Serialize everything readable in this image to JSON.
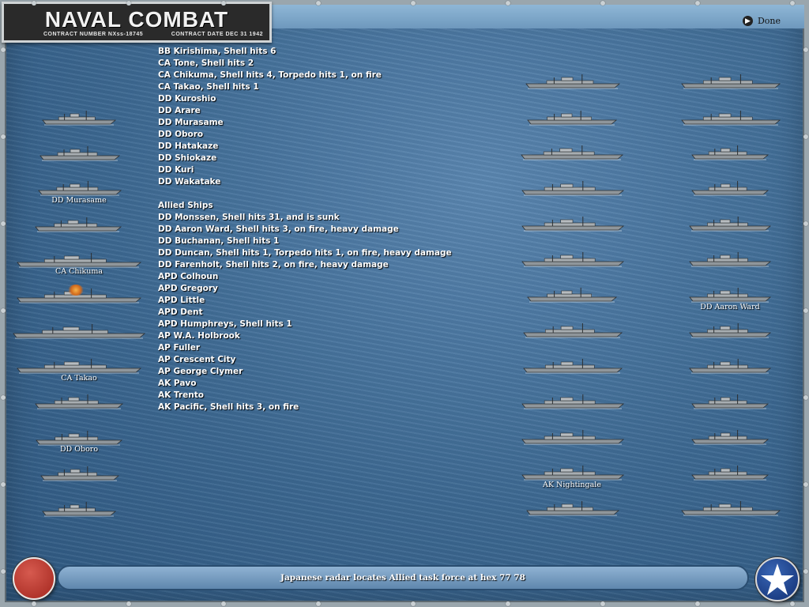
{
  "game": {
    "title": "NAVAL COMBAT",
    "contract_number": "CONTRACT NUMBER   NXss-18745",
    "contract_date": "CONTRACT DATE  DEC  31  1942"
  },
  "done_label": "Done",
  "report_lines": [
    "BB Kirishima, Shell hits 6",
    "CA Tone, Shell hits 2",
    "CA Chikuma, Shell hits 4, Torpedo hits 1,  on fire",
    "CA Takao, Shell hits 1",
    "DD Kuroshio",
    "DD Arare",
    "DD Murasame",
    "DD Oboro",
    "DD Hatakaze",
    "DD Shiokaze",
    "DD Kuri",
    "DD Wakatake",
    "",
    "Allied Ships",
    "DD Monssen, Shell hits 31, and is sunk",
    "DD Aaron Ward, Shell hits 3,  on fire,  heavy damage",
    "DD Buchanan, Shell hits 1",
    "DD Duncan, Shell hits 1, Torpedo hits 1,  on fire,  heavy damage",
    "DD Farenholt, Shell hits 2,  on fire,  heavy damage",
    "APD Colhoun",
    "APD Gregory",
    "APD Little",
    "APD Dent",
    "APD Humphreys, Shell hits 1",
    "AP W.A. Holbrook",
    "AP Fuller",
    "AP Crescent City",
    "AP George Clymer",
    "AK Pavo",
    "AK Trento",
    "AK Pacific, Shell hits 3,  on fire"
  ],
  "ship_labels": {
    "murasame": "DD Murasame",
    "chikuma": "CA Chikuma",
    "takao": "CA Takao",
    "oboro": "DD Oboro",
    "nightingale": "AK Nightingale",
    "aaron_ward": "DD Aaron Ward"
  },
  "status_message": "Japanese radar locates Allied task force at hex 77 78",
  "colors": {
    "ocean": "#3f6a94",
    "japan_button": "#b2352c",
    "allied_button": "#1d3f86"
  },
  "icons": {
    "done": "arrow-circle-icon",
    "allied": "white-star-icon",
    "japan": "red-circle-icon"
  }
}
